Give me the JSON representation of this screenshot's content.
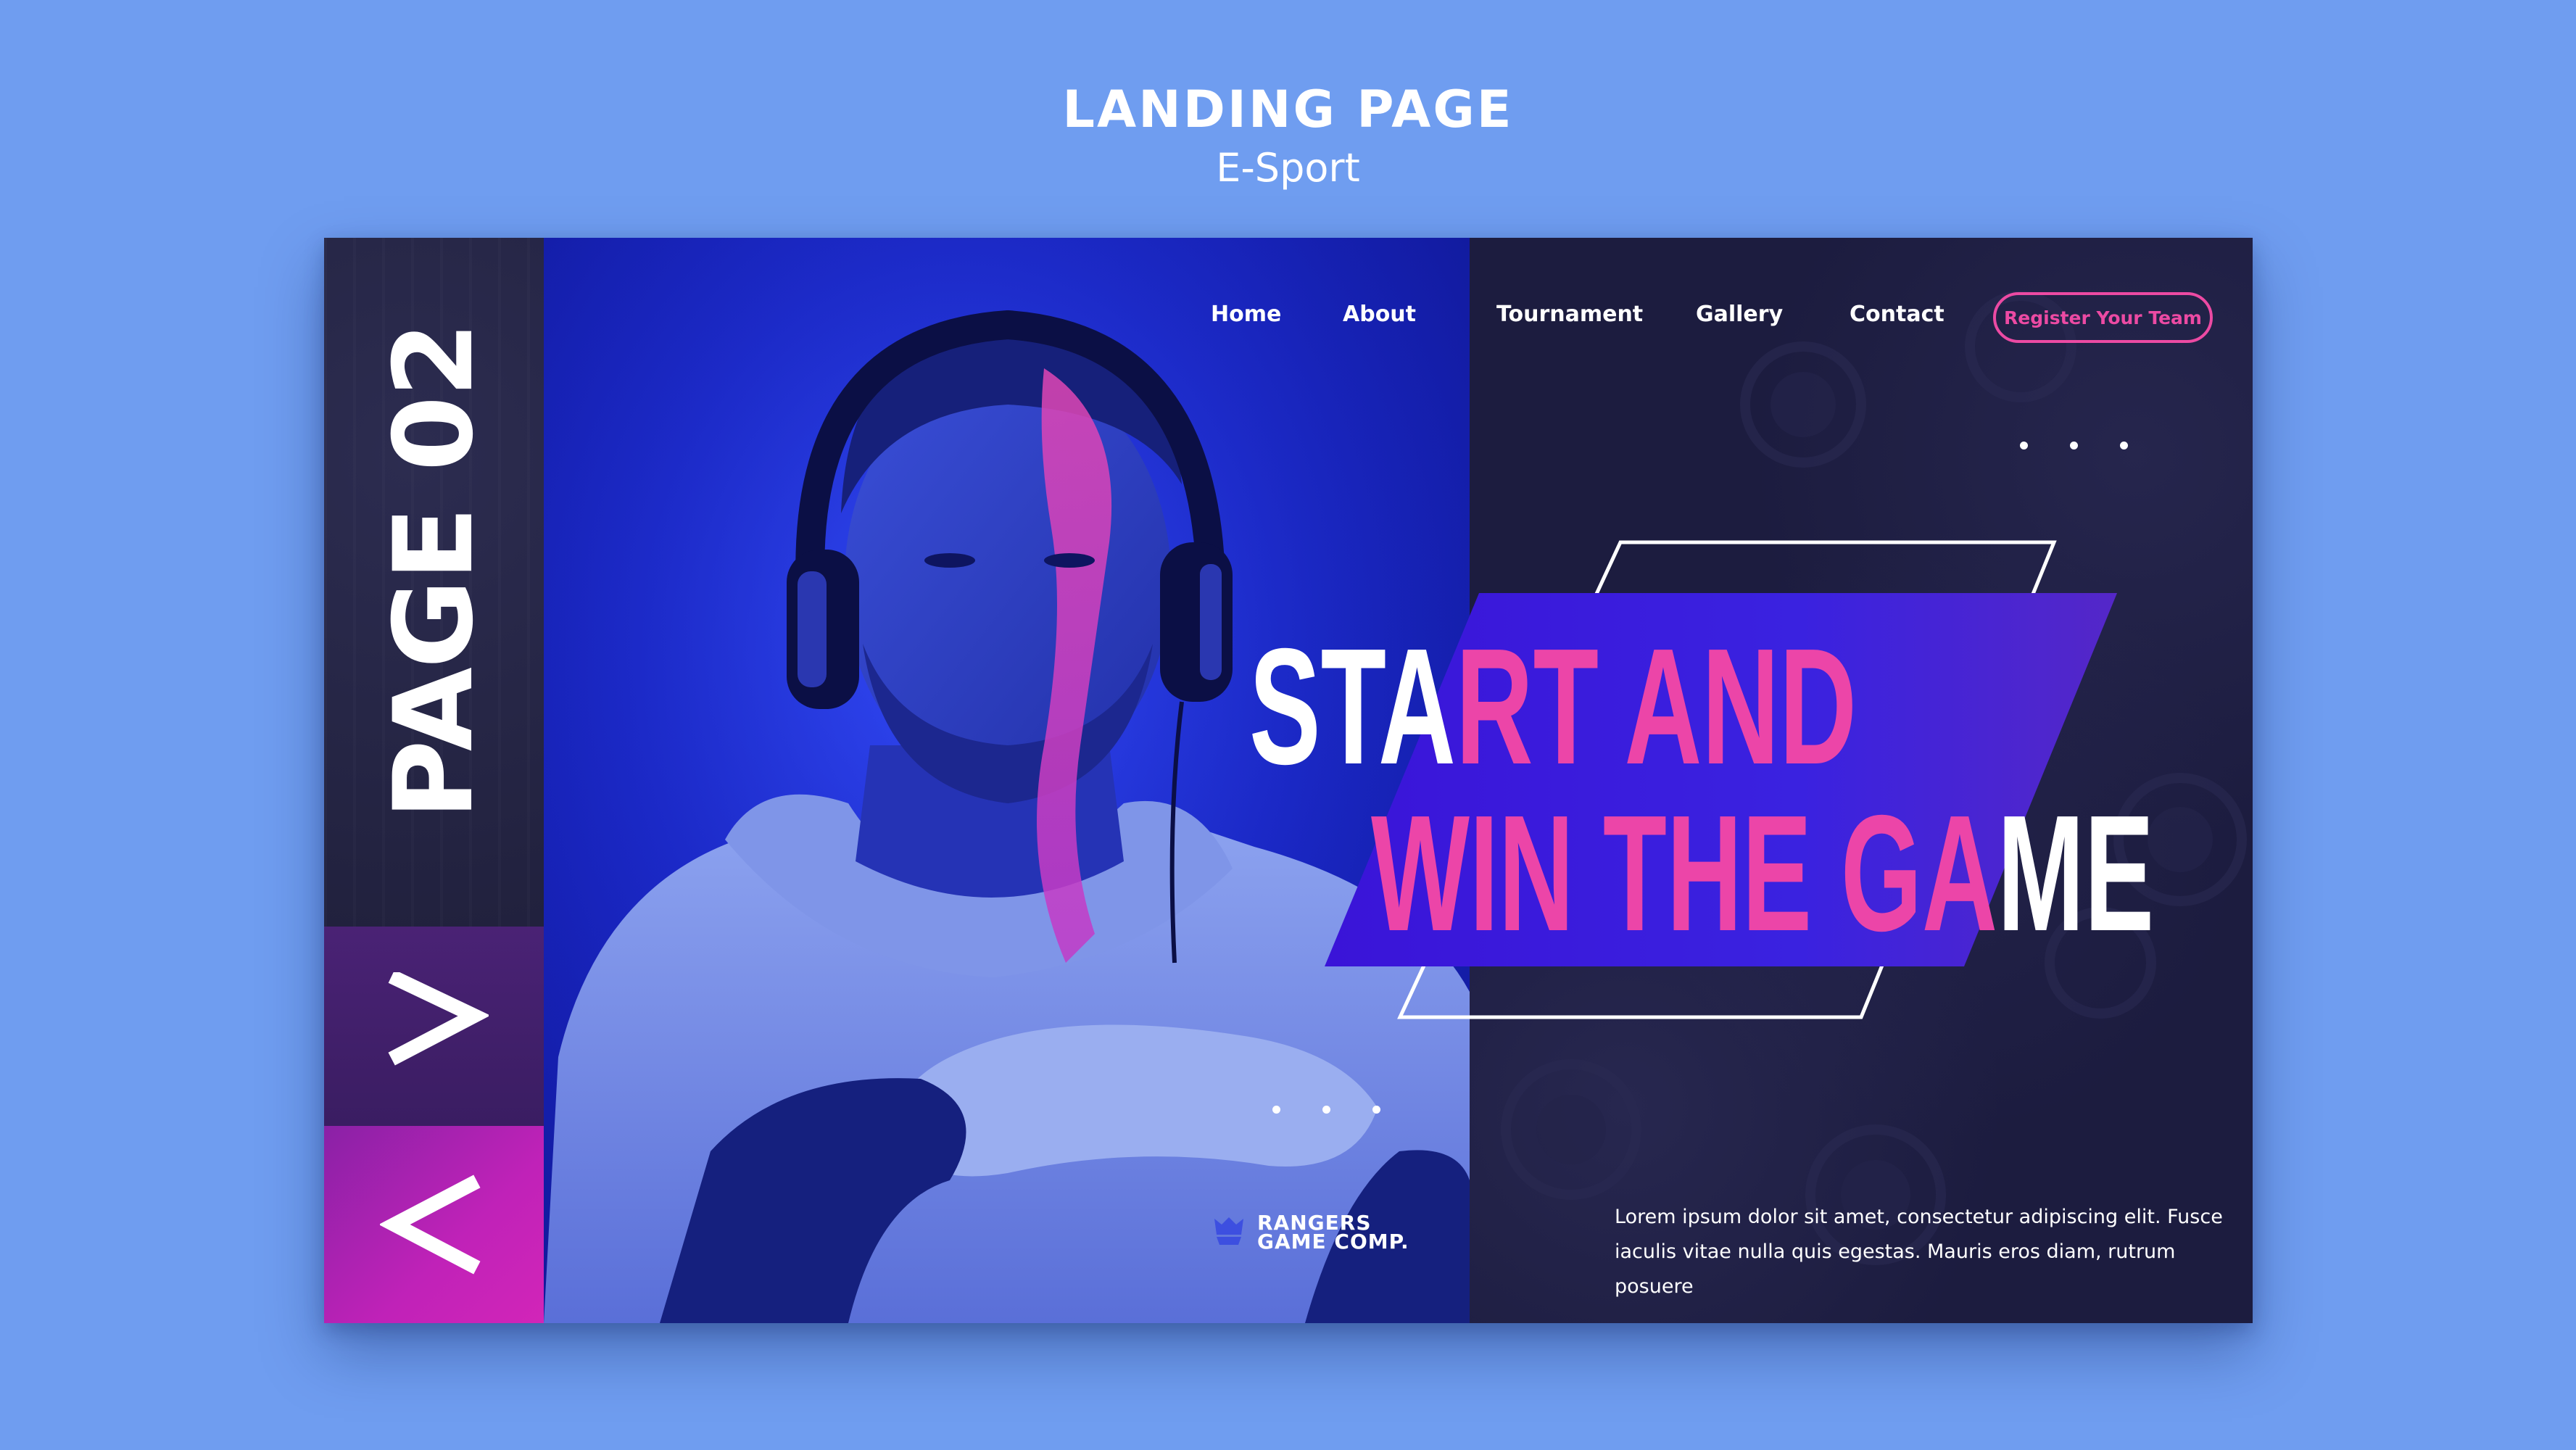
{
  "header": {
    "title": "LANDING PAGE",
    "subtitle": "E-Sport"
  },
  "sidebar": {
    "page_label": "PAGE 02",
    "next_icon": "chevron-right-icon",
    "prev_icon": "chevron-left-icon"
  },
  "nav": {
    "items": [
      "Home",
      "About",
      "Tournament",
      "Gallery",
      "Contact"
    ],
    "cta": "Register Your Team"
  },
  "hero": {
    "line1_white": "STA",
    "line1_pink": "RT AND",
    "line2_pink": "WIN THE GA",
    "line2_white": "ME"
  },
  "brand": {
    "icon": "crown-shield-icon",
    "line1": "RANGERS",
    "line2": "GAME COMP."
  },
  "body": {
    "text": "Lorem ipsum dolor sit amet, consectetur adipiscing elit. Fusce iaculis vitae nulla quis egestas. Mauris eros diam, rutrum posuere"
  },
  "colors": {
    "background": "#6f9df0",
    "panel": "#1c1c3f",
    "accent_pink": "#ec4aa3",
    "accent_blue": "#3019d6",
    "photo_blue": "#1a26c8"
  }
}
